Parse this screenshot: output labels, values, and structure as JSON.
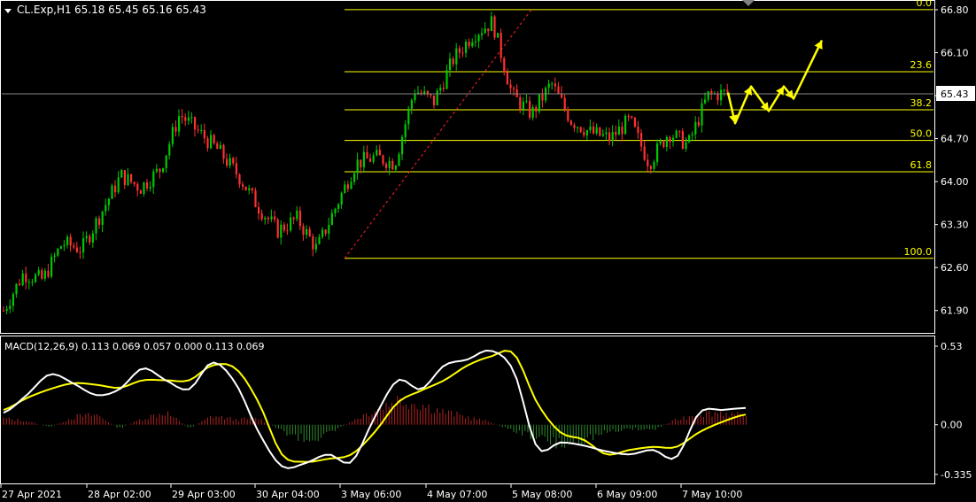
{
  "header": {
    "symbol": "CL.Exp,H1",
    "ohlc": "65.18 65.45 65.16 65.43"
  },
  "macd_header": {
    "text": "MACD(12,26,9) 0.113 0.069 0.057 0.000 0.113 0.069"
  },
  "current_price": "65.43",
  "colors": {
    "background": "#000000",
    "grid_border": "#FFFFFF",
    "bull": "#00C800",
    "bear": "#FF3030",
    "fib": "#FFFF00",
    "macd_line": "#FFFFFF",
    "signal_line": "#FFFF00",
    "hist_pos": "#B22222",
    "hist_neg": "#2E8B2E",
    "arrows": "#FFFF00"
  },
  "chart_data": [
    {
      "type": "candlestick",
      "title": "CL.Exp,H1",
      "y_ticks": [
        "66.80",
        "66.10",
        "65.40",
        "64.70",
        "64.00",
        "63.30",
        "62.60",
        "61.90"
      ],
      "y_tick_values": [
        66.8,
        66.1,
        65.4,
        64.7,
        64.0,
        63.3,
        62.6,
        61.9
      ],
      "ylim": [
        61.55,
        66.9
      ],
      "x_ticks": [
        "27 Apr 2021",
        "28 Apr 02:00",
        "29 Apr 03:00",
        "30 Apr 04:00",
        "3 May 06:00",
        "4 May 07:00",
        "5 May 08:00",
        "6 May 09:00",
        "7 May 10:00"
      ],
      "current_price": 65.43,
      "fibonacci": {
        "levels": [
          "0.0",
          "23.6",
          "38.2",
          "50.0",
          "61.8",
          "100.0"
        ],
        "prices": [
          66.8,
          65.79,
          65.17,
          64.67,
          64.16,
          62.75
        ]
      },
      "trend_line": {
        "from_price": 62.75,
        "to_price": 66.8
      },
      "close_path": [
        [
          "27 Apr 2021",
          61.9
        ],
        [
          "",
          62.5
        ],
        [
          "",
          62.4
        ],
        [
          "",
          63.0
        ],
        [
          "28 Apr 02:00",
          62.9
        ],
        [
          "",
          63.5
        ],
        [
          "",
          64.1
        ],
        [
          "",
          63.9
        ],
        [
          "29 Apr 03:00",
          64.2
        ],
        [
          "",
          65.1
        ],
        [
          "",
          64.8
        ],
        [
          "",
          64.5
        ],
        [
          "",
          64.1
        ],
        [
          "30 Apr 04:00",
          63.6
        ],
        [
          "",
          63.2
        ],
        [
          "",
          63.4
        ],
        [
          "",
          62.9
        ],
        [
          "3 May 06:00",
          63.6
        ],
        [
          "",
          64.3
        ],
        [
          "",
          64.4
        ],
        [
          "",
          64.3
        ],
        [
          "4 May 07:00",
          65.5
        ],
        [
          "",
          65.3
        ],
        [
          "",
          66.0
        ],
        [
          "",
          66.4
        ],
        [
          "5 May 08:00",
          66.6
        ],
        [
          "",
          65.4
        ],
        [
          "",
          65.1
        ],
        [
          "",
          65.6
        ],
        [
          "6 May 09:00",
          65.0
        ],
        [
          "",
          64.8
        ],
        [
          "",
          64.7
        ],
        [
          "",
          65.0
        ],
        [
          "7 May 10:00",
          64.3
        ],
        [
          "",
          64.8
        ],
        [
          "",
          64.6
        ],
        [
          "",
          65.4
        ],
        [
          "",
          65.45
        ]
      ],
      "projection_arrows": [
        65.45,
        64.95,
        65.55,
        65.15,
        65.55,
        65.35,
        66.3
      ]
    },
    {
      "type": "macd",
      "title": "MACD(12,26,9)",
      "params": [
        12,
        26,
        9
      ],
      "values": [
        0.113,
        0.069,
        0.057,
        0.0,
        0.113,
        0.069
      ],
      "y_ticks": [
        "0.53",
        "0.00",
        "-0.335"
      ],
      "y_tick_values": [
        0.53,
        0.0,
        -0.335
      ],
      "ylim": [
        -0.39,
        0.59
      ],
      "macd_path": [
        0.08,
        0.2,
        0.34,
        0.28,
        0.2,
        0.24,
        0.38,
        0.3,
        0.24,
        0.42,
        0.28,
        -0.05,
        -0.28,
        -0.26,
        -0.2,
        -0.25,
        0.05,
        0.3,
        0.24,
        0.4,
        0.44,
        0.5,
        0.36,
        -0.15,
        -0.12,
        -0.14,
        -0.18,
        -0.2,
        -0.17,
        -0.22,
        0.08,
        0.1,
        0.113
      ],
      "signal_path": [
        0.1,
        0.18,
        0.24,
        0.28,
        0.27,
        0.25,
        0.3,
        0.3,
        0.3,
        0.4,
        0.38,
        0.15,
        -0.2,
        -0.25,
        -0.23,
        -0.2,
        -0.05,
        0.15,
        0.23,
        0.3,
        0.4,
        0.46,
        0.48,
        0.15,
        -0.05,
        -0.1,
        -0.2,
        -0.17,
        -0.15,
        -0.15,
        -0.05,
        0.02,
        0.069
      ],
      "histogram": [
        0.05,
        0.03,
        -0.02,
        0.06,
        0.08,
        -0.03,
        0.05,
        0.1,
        -0.03,
        0.07,
        0.04,
        0.05,
        -0.05,
        -0.12,
        -0.08,
        0.03,
        0.12,
        0.2,
        0.16,
        0.1,
        0.06,
        0.02,
        -0.05,
        -0.1,
        -0.16,
        -0.12,
        -0.06,
        -0.03,
        -0.04,
        0.04,
        0.09,
        0.1,
        0.06
      ]
    }
  ]
}
